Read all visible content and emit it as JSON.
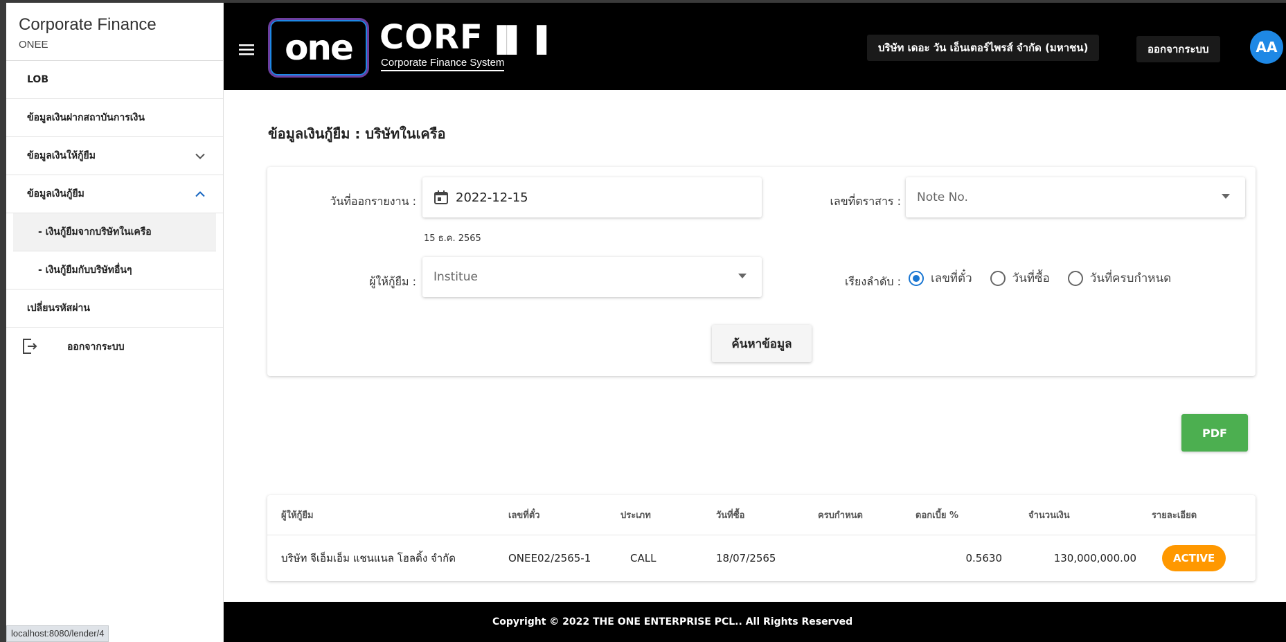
{
  "sidebar": {
    "title": "Corporate Finance",
    "subtitle": "ONEE",
    "items": [
      {
        "label": "LOB"
      },
      {
        "label": "ข้อมูลเงินฝากสถาบันการเงิน"
      },
      {
        "label": "ข้อมูลเงินให้กู้ยืม",
        "chevron": "chevron-down-icon"
      },
      {
        "label": "ข้อมูลเงินกู้ยืม",
        "chevron": "chevron-up-icon"
      },
      {
        "label": "- เงินกู้ยืมจากบริษัทในเครือ",
        "active": true
      },
      {
        "label": "- เงินกู้ยืมกับบริษัทอื่นๆ"
      },
      {
        "label": "เปลี่ยนรหัสผ่าน"
      },
      {
        "label": "ออกจากระบบ",
        "icon": "logout-icon"
      }
    ]
  },
  "status_url": "localhost:8080/lender/4",
  "header": {
    "menu_icon": "hamburger-icon",
    "logo_one": "one",
    "logo_corf": "CORF",
    "logo_sub": "Corporate Finance System",
    "company": "บริษัท เดอะ วัน เอ็นเตอร์ไพรส์ จำกัด (มหาชน)",
    "logout": "ออกจากระบบ",
    "avatar": "AA"
  },
  "page": {
    "title": "ข้อมูลเงินกู้ยืม : บริษัทในเครือ"
  },
  "filters": {
    "report_date_label": "วันที่ออกรายงาน :",
    "report_date_value": "2022-12-15",
    "report_date_hint": "15 ธ.ค. 2565",
    "note_label": "เลขที่ตราสาร :",
    "note_placeholder": "Note No.",
    "lender_label": "ผู้ให้กู้ยืม :",
    "lender_placeholder": "Institue",
    "sort_label": "เรียงลำดับ :",
    "sort_options": [
      "เลขที่ตั๋ว",
      "วันที่ซื้อ",
      "วันที่ครบกำหนด"
    ],
    "sort_selected": 0,
    "search_button": "ค้นหาข้อมูล"
  },
  "pdf_button": "PDF",
  "table": {
    "columns": [
      "ผู้ให้กู้ยืม",
      "เลขที่ตั๋ว",
      "ประเภท",
      "วันที่ซื้อ",
      "ครบกำหนด",
      "ดอกเบี้ย %",
      "จำนวนเงิน",
      "รายละเอียด"
    ],
    "rows": [
      {
        "lender": "บริษัท จีเอ็มเอ็ม แชนแนล โฮลดิ้ง จำกัด",
        "ticket": "ONEE02/2565-1",
        "type": "CALL",
        "buy_date": "18/07/2565",
        "maturity": "",
        "interest": "0.5630",
        "amount": "130,000,000.00",
        "status": "ACTIVE"
      }
    ]
  },
  "footer": "Copyright © 2022 THE ONE ENTERPRISE PCL.. All Rights Reserved",
  "colors": {
    "primary": "#1976d2",
    "pdf": "#4caf50",
    "active": "#ff9800",
    "header_bg": "#000000"
  }
}
